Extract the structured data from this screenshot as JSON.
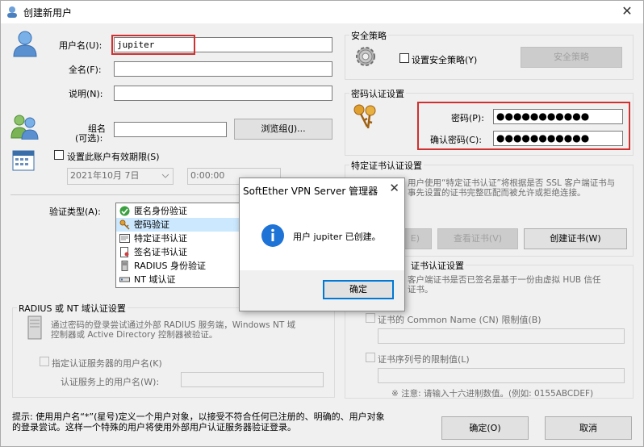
{
  "window": {
    "title": "创建新用户",
    "close": "✕"
  },
  "user": {
    "username_label": "用户名(U):",
    "username_value": "jupiter",
    "fullname_label": "全名(F):",
    "fullname_value": "",
    "note_label": "说明(N):",
    "note_value": "",
    "group_label_1": "组名",
    "group_label_2": "(可选):",
    "group_value": "",
    "browse_group": "浏览组(J)...",
    "expire_label": "设置此账户有效期限(S)",
    "expire_date": "2021年10月 7日",
    "expire_time": "0:00:00"
  },
  "auth": {
    "type_label": "验证类型(A):",
    "items": [
      {
        "label": "匿名身份验证",
        "selected": false
      },
      {
        "label": "密码验证",
        "selected": true
      },
      {
        "label": "特定证书认证",
        "selected": false
      },
      {
        "label": "签名证书认证",
        "selected": false
      },
      {
        "label": "RADIUS 身份验证",
        "selected": false
      },
      {
        "label": "NT 域认证",
        "selected": false
      }
    ]
  },
  "radius": {
    "group_title": "RADIUS 或 NT 域认证设置",
    "desc_1": "通过密码的登录尝试通过外部 RADIUS 服务端，Windows NT 域",
    "desc_2": "控制器或 Active Directory 控制器被验证。",
    "specify_label": "指定认证服务器的用户名(K)",
    "server_user_label": "认证服务上的用户名(W):",
    "server_user_value": ""
  },
  "security": {
    "group_title": "安全策略",
    "set_policy_label": "设置安全策略(Y)",
    "policy_button": "安全策略"
  },
  "password": {
    "group_title": "密码认证设置",
    "pwd_label": "密码(P):",
    "pwd_value": "●●●●●●●●●●●",
    "confirm_label": "确认密码(C):",
    "confirm_value": "●●●●●●●●●●●"
  },
  "cert": {
    "group_title": "特定证书认证设置",
    "desc_1": "用户使用“特定证书认证”将根据是否 SSL 客户端证书与",
    "desc_2": "事先设置的证书完整匹配而被允许或拒绝连接。",
    "load_button": "E)",
    "view_button": "查看证书(V)",
    "create_button": "创建证书(W)"
  },
  "signed": {
    "group_title": "证书认证设置",
    "desc_1": "客户端证书是否已签名是基于一份由虚拟 HUB 信任",
    "desc_2": "证书。",
    "cn_label": "证书的 Common Name (CN) 限制值(B)",
    "cn_value": "",
    "serial_label": "证书序列号的限制值(L)",
    "serial_value": "",
    "note": "※ 注意: 请输入十六进制数值。(例如: 0155ABCDEF)"
  },
  "footer": {
    "hint_1": "提示: 使用用户名“*”(星号)定义一个用户对象，以接受不符合任何已注册的、明确的、用户对象",
    "hint_2": "的登录尝试。这样一个特殊的用户将使用外部用户认证服务器验证登录。",
    "ok": "确定(O)",
    "cancel": "取消"
  },
  "dialog": {
    "title": "SoftEther VPN Server 管理器",
    "message": "用户 jupiter 已创建。",
    "ok": "确定",
    "close": "✕"
  },
  "colors": {
    "highlight": "#d03030",
    "info_blue": "#1e73d6",
    "selected_bg": "#cce8ff"
  }
}
